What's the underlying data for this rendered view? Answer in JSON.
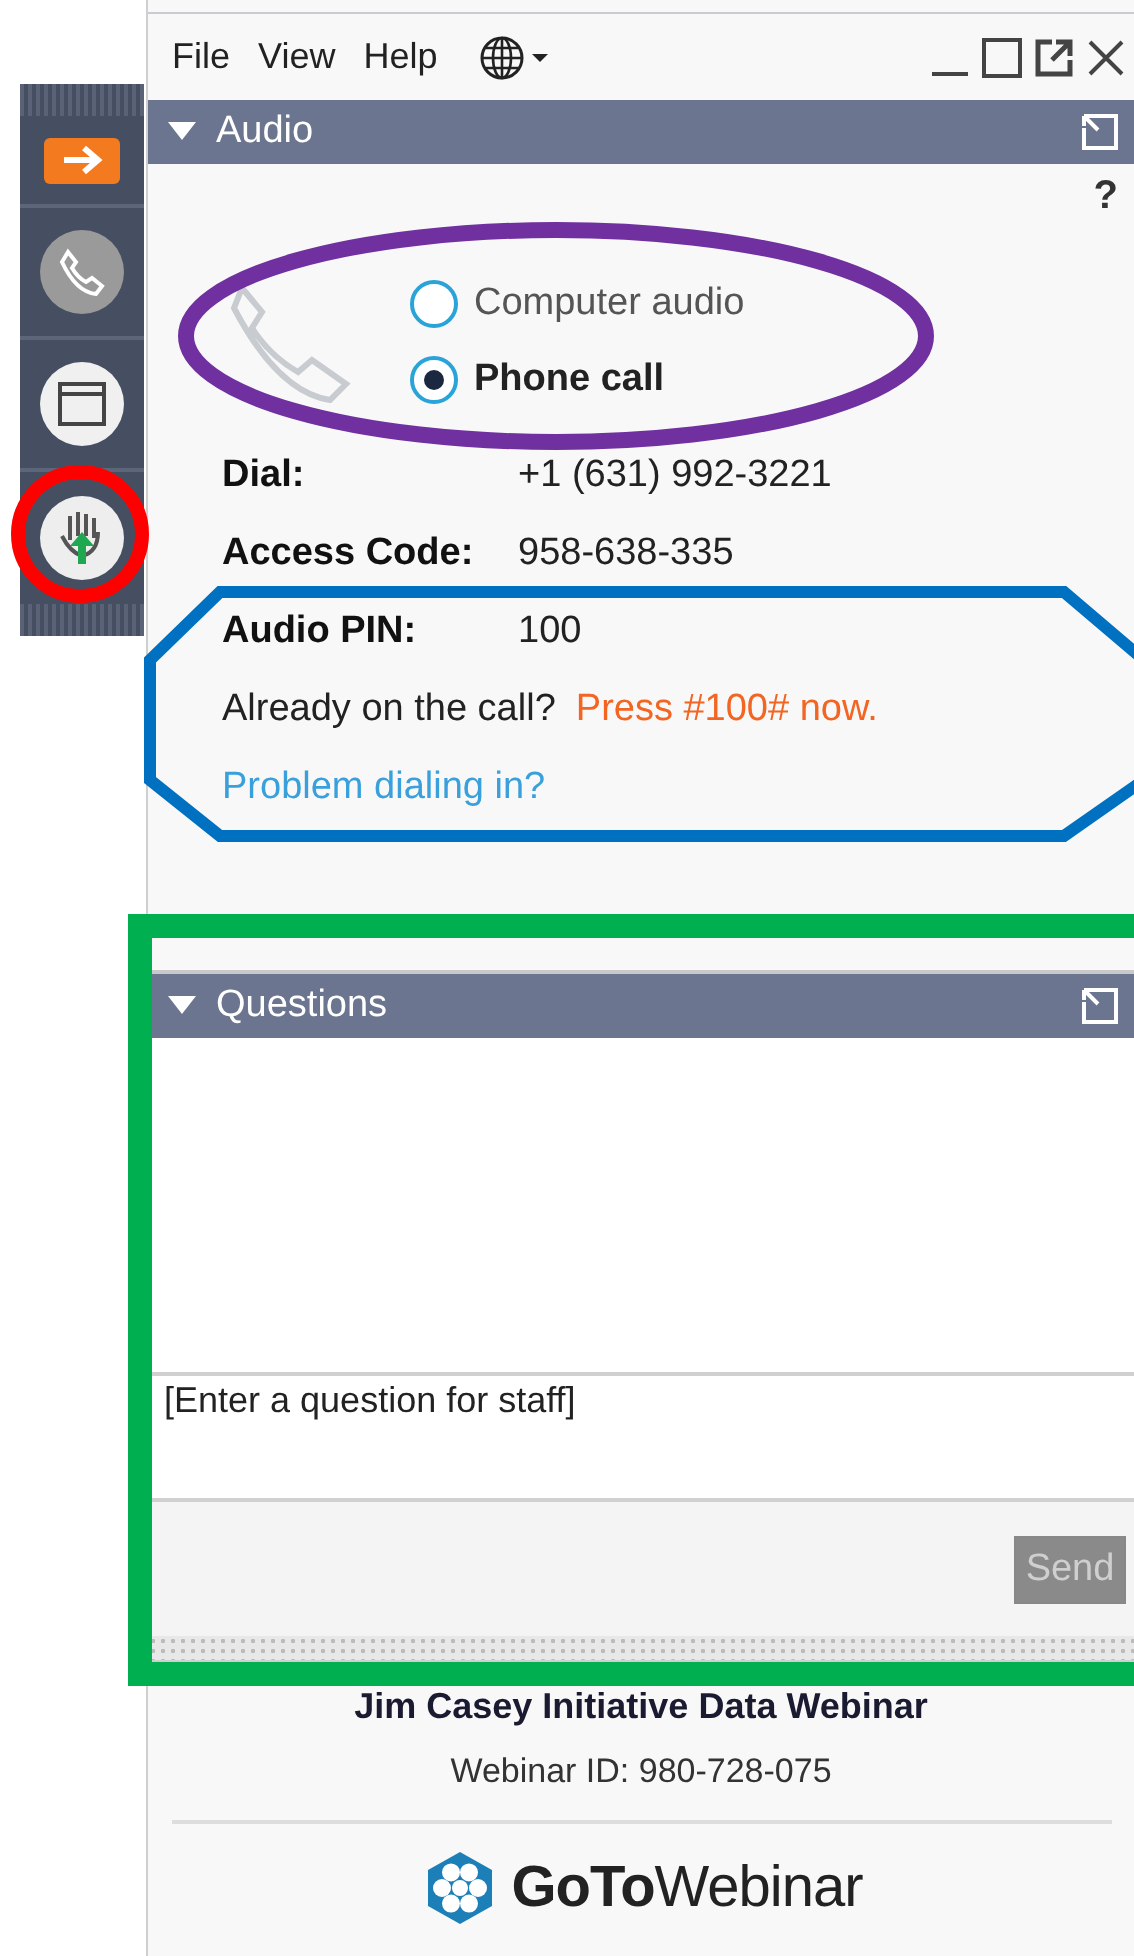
{
  "menu": [
    {
      "label": "File"
    },
    {
      "label": "View"
    },
    {
      "label": "Help"
    }
  ],
  "audio": {
    "title": "Audio",
    "expanded": true,
    "help": "?",
    "options": [
      {
        "label": "Computer audio",
        "selected": false
      },
      {
        "label": "Phone call",
        "selected": true
      }
    ],
    "details": [
      {
        "label": "Dial:",
        "value": "+1 (631) 992-3221"
      },
      {
        "label": "Access Code:",
        "value": "958-638-335"
      },
      {
        "label": "Audio PIN:",
        "value": "100"
      }
    ],
    "already": {
      "text": "Already on the call?",
      "action": "Press #100# now."
    },
    "link": "Problem dialing in?"
  },
  "questions": {
    "title": "Questions",
    "expanded": true,
    "placeholder": "[Enter a question for staff]",
    "send": {
      "label": "Send",
      "disabled": true
    }
  },
  "footer": {
    "title": "Jim Casey Initiative Data Webinar",
    "webinar_id": "Webinar ID: 980-728-075",
    "brand": "**GoTo**Webinar"
  },
  "annotations": [
    {
      "kind": "ellipse",
      "color": "#7030a0"
    },
    {
      "kind": "circle",
      "color": "#ff0000"
    },
    {
      "kind": "octagon",
      "color": "#0070c0"
    },
    {
      "kind": "rectangle",
      "color": "#00b050"
    }
  ]
}
